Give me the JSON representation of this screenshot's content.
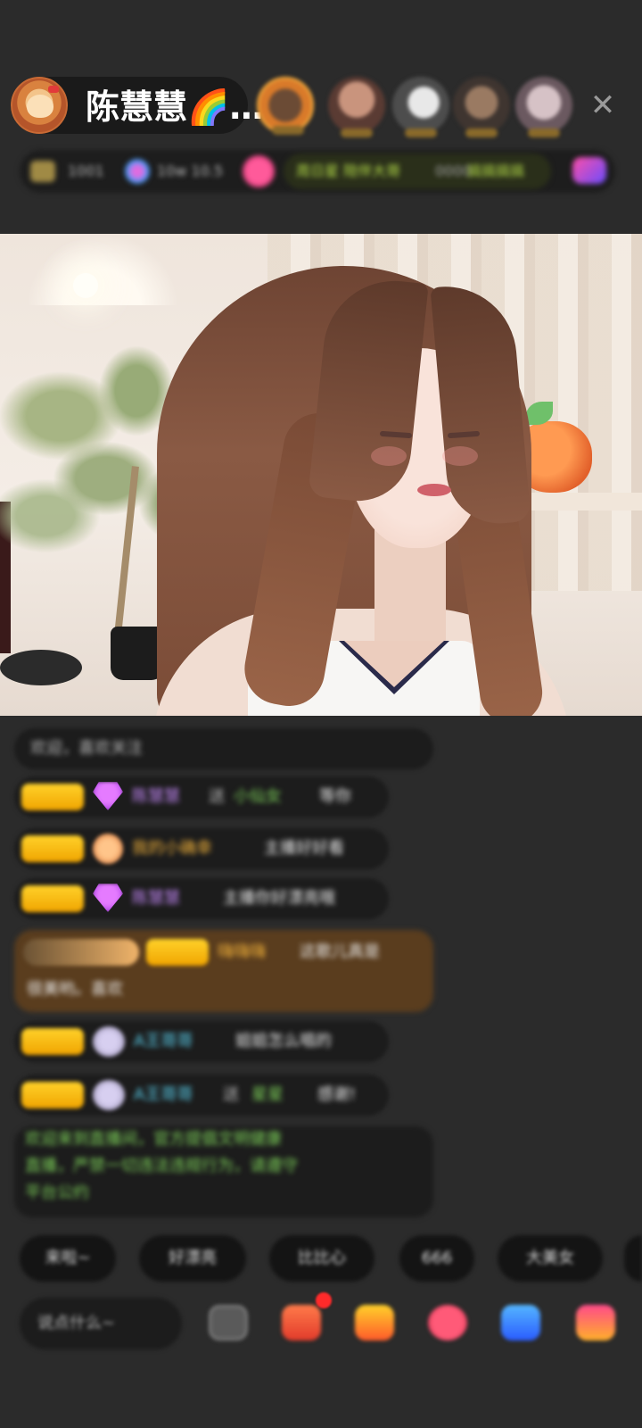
{
  "host": {
    "name": "陈慧慧🌈…"
  },
  "header": {
    "close_glyph": "✕"
  },
  "stats": {
    "item1": "1001",
    "item2": "10w 10.5",
    "item3": "周日星 陪伴大哥",
    "item4": "0000",
    "item5": "搞搞搞搞"
  },
  "chat": [
    {
      "id": "welcome",
      "text": "欢迎，喜欢关注"
    },
    {
      "id": "m1",
      "badge_color": "#f0b800",
      "icon": "gem-icon",
      "name": "陈慧慧",
      "mid": "送",
      "target": "小仙女",
      "text": "等你"
    },
    {
      "id": "m2",
      "badge_color": "#f0b800",
      "icon": "ball-icon",
      "name": "我的小确幸",
      "text": "主播好好看"
    },
    {
      "id": "m3",
      "badge_color": "#f0b800",
      "icon": "gem-icon",
      "name": "陈慧慧",
      "text": "主播你好漂亮哦"
    },
    {
      "id": "m4",
      "highlight": true,
      "name": "嗨嗨嗨",
      "text": "这歌儿真是",
      "text2": "很美哟。喜欢"
    },
    {
      "id": "m5",
      "badge_color": "#f0b800",
      "icon": "bubble-icon",
      "name": "A王哥哥",
      "text": "姐姐怎么唱的"
    },
    {
      "id": "m6",
      "badge_color": "#f0b800",
      "icon": "bubble-icon",
      "name": "A王哥哥",
      "mid": "送",
      "target": "星星",
      "text": "感谢!"
    },
    {
      "id": "notice",
      "text_lines": [
        "欢迎来到直播间，官方提倡文明健康",
        "直播，严禁一切违法违规行为，请遵守",
        "平台公约"
      ]
    }
  ],
  "quick_replies": [
    "来啦~",
    "好漂亮",
    "比比心",
    "666",
    "大美女"
  ],
  "input": {
    "placeholder": "说点什么~"
  },
  "toolbar": {
    "emoji": "emoji-icon",
    "gift": "gift-icon",
    "gold": "gold-icon",
    "heart": "heart-icon",
    "game": "game-icon",
    "box": "box-icon"
  }
}
